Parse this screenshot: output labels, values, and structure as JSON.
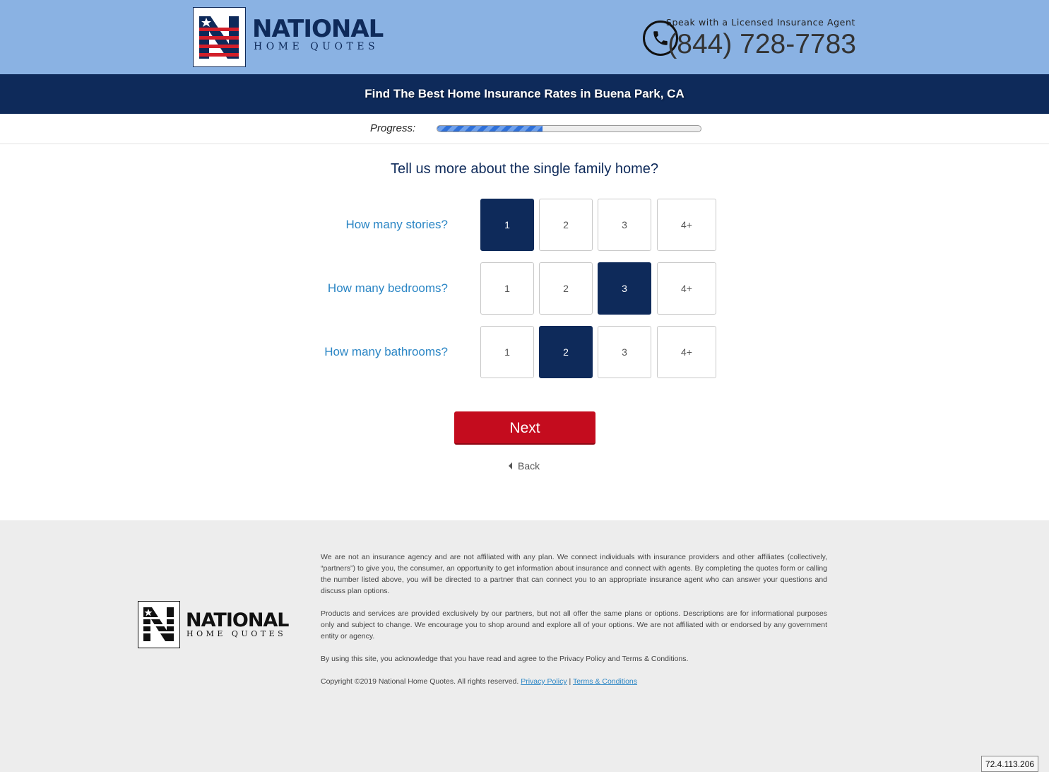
{
  "header": {
    "logo_main": "NATIONAL",
    "logo_sub": "HOME QUOTES",
    "speak_text": "Speak with a Licensed Insurance Agent",
    "phone": "(844) 728-7783"
  },
  "banner": {
    "text": "Find The Best Home Insurance Rates in Buena Park, CA"
  },
  "progress": {
    "label": "Progress:",
    "value_percent": 40
  },
  "form": {
    "title": "Tell us more about the single family home?",
    "questions": [
      {
        "label": "How many stories?",
        "options": [
          "1",
          "2",
          "3",
          "4+"
        ],
        "selected": "1"
      },
      {
        "label": "How many bedrooms?",
        "options": [
          "1",
          "2",
          "3",
          "4+"
        ],
        "selected": "3"
      },
      {
        "label": "How many bathrooms?",
        "options": [
          "1",
          "2",
          "3",
          "4+"
        ],
        "selected": "2"
      }
    ],
    "next_label": "Next",
    "back_label": "Back"
  },
  "footer": {
    "logo_main": "NATIONAL",
    "logo_sub": "HOME QUOTES",
    "para1": "We are not an insurance agency and are not affiliated with any plan. We connect individuals with insurance providers and other affiliates (collectively, “partners”) to give you, the consumer, an opportunity to get information about insurance and connect with agents. By completing the quotes form or calling the number listed above, you will be directed to a partner that can connect you to an appropriate insurance agent who can answer your questions and discuss plan options.",
    "para2": "Products and services are provided exclusively by our partners, but not all offer the same plans or options. Descriptions are for informational purposes only and subject to change. We encourage you to shop around and explore all of your options. We are not affiliated with or endorsed by any government entity or agency.",
    "para3": "By using this site, you acknowledge that you have read and agree to the Privacy Policy and Terms & Conditions.",
    "copyright": "Copyright ©2019 National Home Quotes. All rights reserved.",
    "privacy_link": "Privacy Policy",
    "separator": "|",
    "terms_link": "Terms & Conditions"
  },
  "ip_badge": "72.4.113.206",
  "colors": {
    "header_bg": "#8ab2e3",
    "navy": "#0e2a5a",
    "accent_red": "#c40c1e",
    "label_blue": "#2b86c5",
    "footer_bg": "#ededed"
  }
}
